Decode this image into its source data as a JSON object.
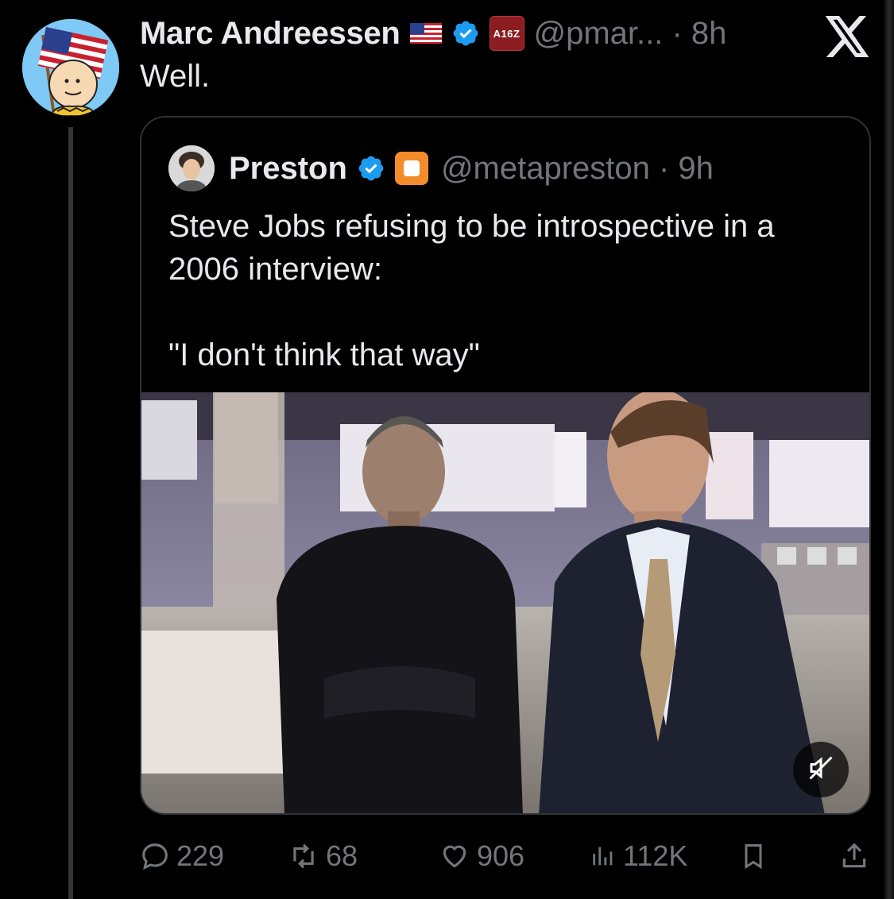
{
  "tweet": {
    "author": {
      "display_name": "Marc Andreessen",
      "handle_time": "@pmar... · 8h",
      "badge_label": "A16Z",
      "avatar": "charlie-brown-flag-avatar"
    },
    "text": "Well.",
    "quote": {
      "author": {
        "display_name": "Preston",
        "handle_time": "@metapreston · 9h",
        "avatar": "person-avatar"
      },
      "text_line1": "Steve Jobs refusing to be introspective in a 2006 interview:",
      "text_line2": "\"I don't think that way\"",
      "media": {
        "type": "video",
        "icon": "mute-icon"
      }
    },
    "actions": {
      "replies": "229",
      "reposts": "68",
      "likes": "906",
      "views": "112K"
    }
  },
  "colors": {
    "background": "#000000",
    "text": "#e7e9ea",
    "muted": "#71767b",
    "verified": "#1d9bf0",
    "border": "#2f3336"
  }
}
